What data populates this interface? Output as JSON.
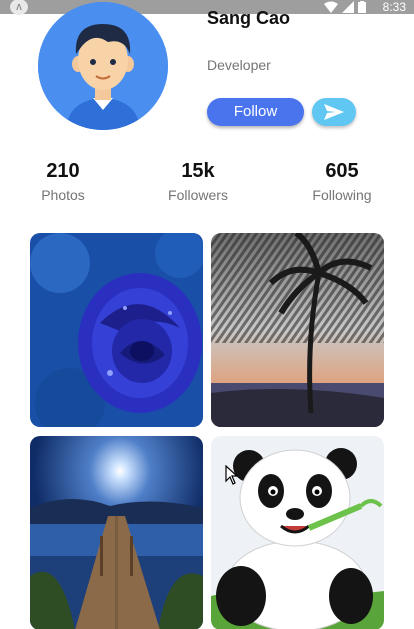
{
  "status_bar": {
    "time": "8:33",
    "app_icon": "android-icon",
    "icons": [
      "wifi-icon",
      "signal-icon",
      "battery-icon"
    ]
  },
  "profile": {
    "name": "Sang Cao",
    "role": "Developer",
    "avatar_icon": "user-avatar"
  },
  "actions": {
    "follow_label": "Follow",
    "send_icon": "send-icon"
  },
  "stats": [
    {
      "value": "210",
      "label": "Photos"
    },
    {
      "value": "15k",
      "label": "Followers"
    },
    {
      "value": "605",
      "label": "Following"
    }
  ],
  "photos": [
    "blue-rose",
    "palm-tree-sunset",
    "lake-pier-moonlight",
    "panda"
  ],
  "colors": {
    "follow": "#4a74ee",
    "send": "#5fc7f2",
    "avatar_bg": "#4a8ff0"
  }
}
